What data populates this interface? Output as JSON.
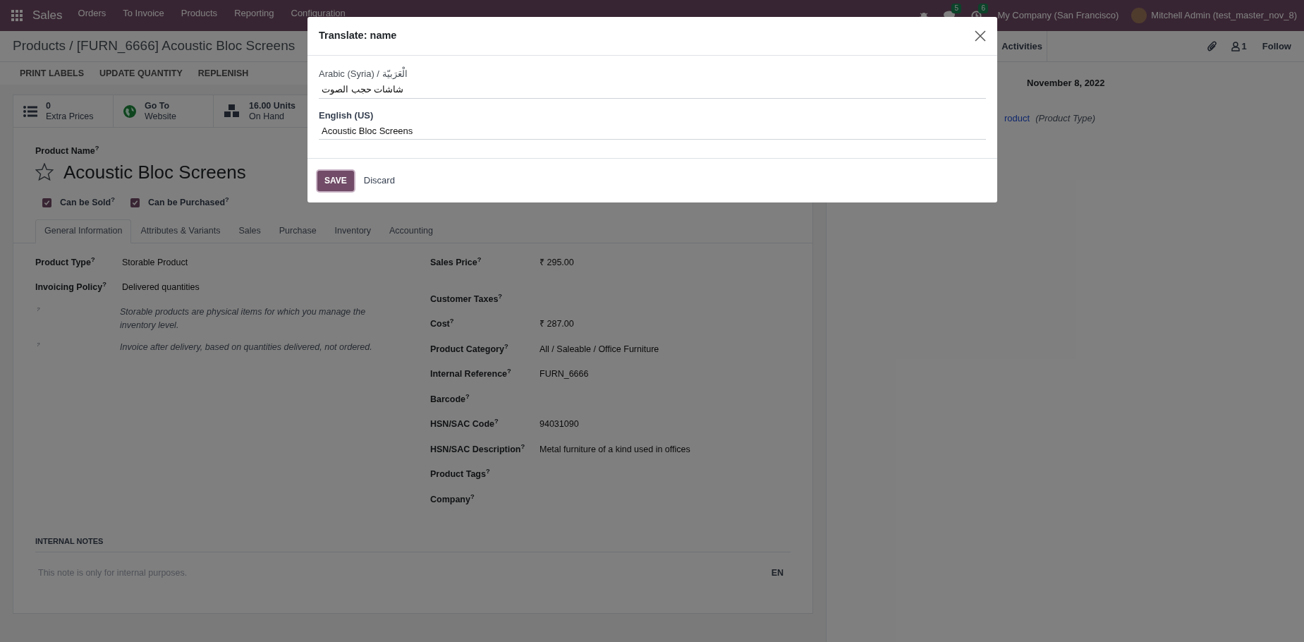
{
  "navbar": {
    "app_name": "Sales",
    "menu": [
      "Orders",
      "To Invoice",
      "Products",
      "Reporting",
      "Configuration"
    ],
    "messages_count": "5",
    "activities_count": "6",
    "company": "My Company (San Francisco)",
    "user": "Mitchell Admin (test_master_nov_8)"
  },
  "breadcrumb": "Products / [FURN_6666] Acoustic Bloc Screens",
  "actions": [
    "PRINT LABELS",
    "UPDATE QUANTITY",
    "REPLENISH"
  ],
  "stat_buttons": [
    {
      "kind": "list",
      "value": "0",
      "label": "Extra Prices"
    },
    {
      "kind": "globe",
      "value": "Go To",
      "label": "Website"
    },
    {
      "kind": "cubes",
      "value": "16.00 Units",
      "label": "On Hand"
    }
  ],
  "product": {
    "name_label": "Product Name$^{?}$",
    "name": "Acoustic Bloc Screens",
    "favorite": false,
    "checkboxes": [
      {
        "label": "Can be Sold$^{?}$",
        "checked": true
      },
      {
        "label": "Can be Purchased$^{?}$",
        "checked": true
      }
    ]
  },
  "tabs": [
    {
      "label": "General Information",
      "selected": true
    },
    {
      "label": "Attributes & Variants",
      "selected": false
    },
    {
      "label": "Sales",
      "selected": false
    },
    {
      "label": "Purchase",
      "selected": false
    },
    {
      "label": "Inventory",
      "selected": false
    },
    {
      "label": "Accounting",
      "selected": false
    }
  ],
  "left_fields": [
    {
      "label": "Product Type$^{?}$",
      "value": "Storable Product"
    },
    {
      "label": "Invoicing Policy$^{?}$",
      "value": "Delivered quantities"
    }
  ],
  "help_notes": [
    {
      "mark": "?",
      "text": "Storable products are physical items for which you manage the inventory level."
    },
    {
      "mark": "?",
      "text": "Invoice after delivery, based on quantities delivered, not ordered."
    }
  ],
  "right_fields": [
    {
      "label": "Sales Price$^{?}$",
      "value": "₹ 295.00"
    },
    {
      "label": "Customer Taxes$^{?}$"
    },
    {
      "label": "Cost$^{?}$",
      "value": "₹ 287.00"
    },
    {
      "label": "Product Category$^{?}$",
      "value": "All / Saleable / Office Furniture"
    },
    {
      "label": "Internal Reference$^{?}$",
      "value": "FURN_6666"
    },
    {
      "label": "Barcode$^{?}$"
    },
    {
      "label": "HSN/SAC Code$^{?}$",
      "value": "94031090"
    },
    {
      "label": "HSN/SAC Description$^{?}$",
      "value": "Metal furniture of a kind used in offices"
    },
    {
      "label": "Product Tags$^{?}$"
    },
    {
      "label": "Company$^{?}$"
    }
  ],
  "internal_notes": {
    "title": "INTERNAL NOTES",
    "placeholder": "This note is only for internal purposes.",
    "language": "EN"
  },
  "chatter": {
    "activities": "Activities",
    "followers_count": "1",
    "follow": "Follow",
    "date": "November 8, 2022",
    "tracking_value": "roduct",
    "tracking_field": "(Product Type)"
  },
  "dialog": {
    "title": "Translate: name",
    "fields": [
      {
        "label": "Arabic (Syria) / الْعَرَبيّة",
        "value": "شاشات حجب الصوت",
        "current_language": false
      },
      {
        "label": "English (US)",
        "value": "Acoustic Bloc Screens",
        "current_language": true
      }
    ],
    "save": "SAVE",
    "discard": "Discard"
  }
}
